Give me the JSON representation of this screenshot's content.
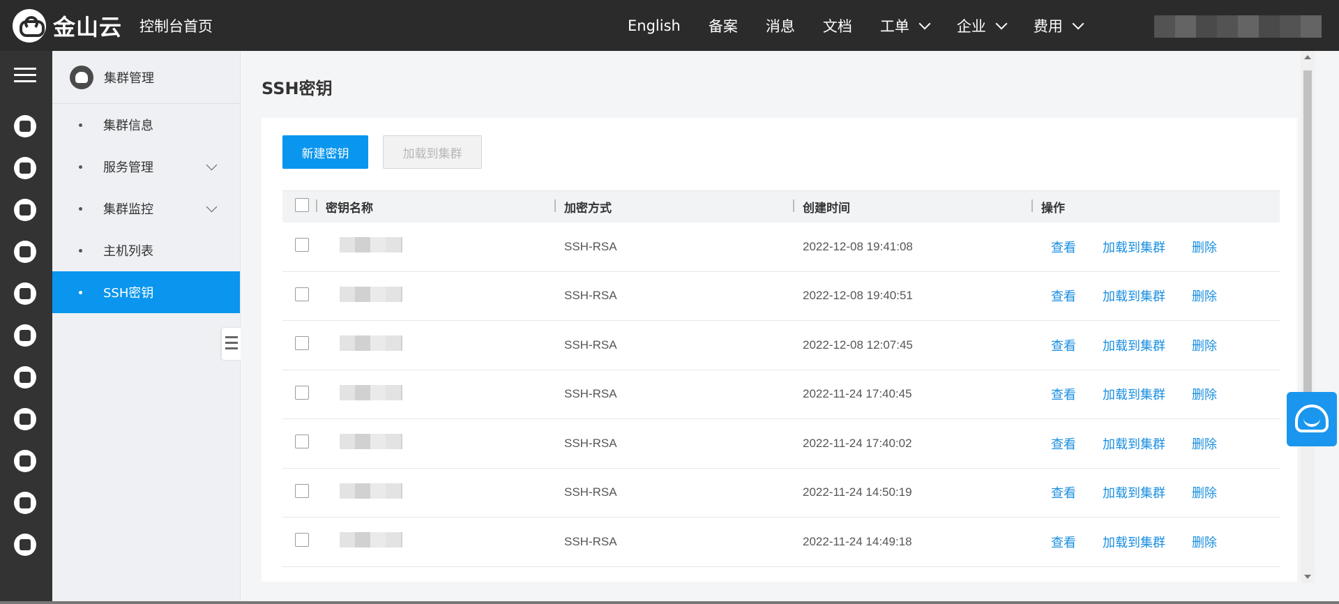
{
  "brand": {
    "name": "金山云",
    "home_link": "控制台首页"
  },
  "topnav": [
    {
      "label": "English",
      "has_menu": false
    },
    {
      "label": "备案",
      "has_menu": false
    },
    {
      "label": "消息",
      "has_menu": false
    },
    {
      "label": "文档",
      "has_menu": false
    },
    {
      "label": "工单",
      "has_menu": true
    },
    {
      "label": "企业",
      "has_menu": true
    },
    {
      "label": "费用",
      "has_menu": true
    }
  ],
  "sidebar": {
    "header": "集群管理",
    "items": [
      {
        "label": "集群信息",
        "expandable": false,
        "active": false
      },
      {
        "label": "服务管理",
        "expandable": true,
        "active": false
      },
      {
        "label": "集群监控",
        "expandable": true,
        "active": false
      },
      {
        "label": "主机列表",
        "expandable": false,
        "active": false
      },
      {
        "label": "SSH密钥",
        "expandable": false,
        "active": true
      }
    ]
  },
  "page": {
    "title": "SSH密钥",
    "new_button": "新建密钥",
    "load_button": "加载到集群"
  },
  "table": {
    "headers": {
      "name": "密钥名称",
      "encryption": "加密方式",
      "created": "创建时间",
      "actions": "操作"
    },
    "action_labels": {
      "view": "查看",
      "load": "加载到集群",
      "delete": "删除"
    },
    "rows": [
      {
        "encryption": "SSH-RSA",
        "created": "2022-12-08 19:41:08"
      },
      {
        "encryption": "SSH-RSA",
        "created": "2022-12-08 19:40:51"
      },
      {
        "encryption": "SSH-RSA",
        "created": "2022-12-08 12:07:45"
      },
      {
        "encryption": "SSH-RSA",
        "created": "2022-11-24 17:40:45"
      },
      {
        "encryption": "SSH-RSA",
        "created": "2022-11-24 17:40:02"
      },
      {
        "encryption": "SSH-RSA",
        "created": "2022-11-24 14:50:19"
      },
      {
        "encryption": "SSH-RSA",
        "created": "2022-11-24 14:49:18"
      }
    ]
  },
  "colors": {
    "accent": "#0a96ee",
    "topbar": "#2b2b2b",
    "rail": "#333333",
    "link": "#1a8fe0"
  }
}
